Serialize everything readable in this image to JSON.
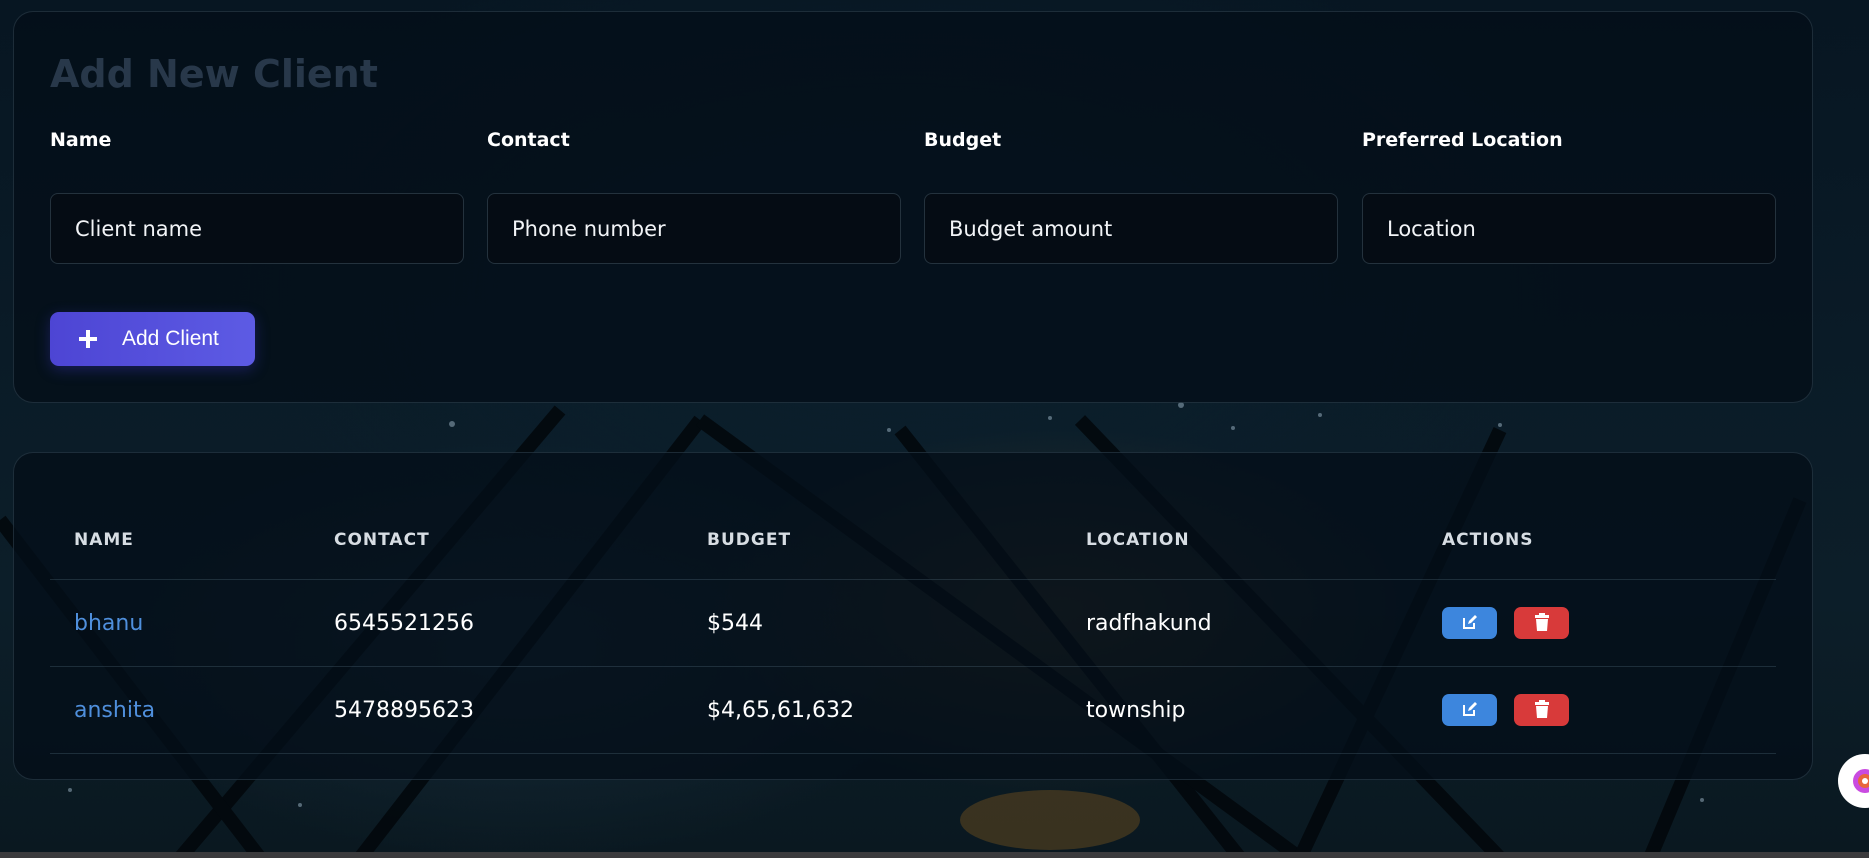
{
  "form": {
    "title": "Add New Client",
    "fields": [
      {
        "label": "Name",
        "placeholder": "Client name"
      },
      {
        "label": "Contact",
        "placeholder": "Phone number"
      },
      {
        "label": "Budget",
        "placeholder": "Budget amount"
      },
      {
        "label": "Preferred Location",
        "placeholder": "Location"
      }
    ],
    "submit_label": "Add Client",
    "submit_icon": "plus-icon"
  },
  "table": {
    "headers": [
      "NAME",
      "CONTACT",
      "BUDGET",
      "LOCATION",
      "ACTIONS"
    ],
    "rows": [
      {
        "name": "bhanu",
        "contact": "6545521256",
        "budget": "$544",
        "location": "radfhakund"
      },
      {
        "name": "anshita",
        "contact": "5478895623",
        "budget": "$4,65,61,632",
        "location": "township"
      }
    ],
    "action_icons": [
      "edit-icon",
      "trash-icon"
    ]
  },
  "colors": {
    "accent": "#4d45d4",
    "link": "#4f8fdc",
    "edit": "#3d86dd",
    "delete": "#d83a3a"
  },
  "widget_icon": "assistant-icon"
}
